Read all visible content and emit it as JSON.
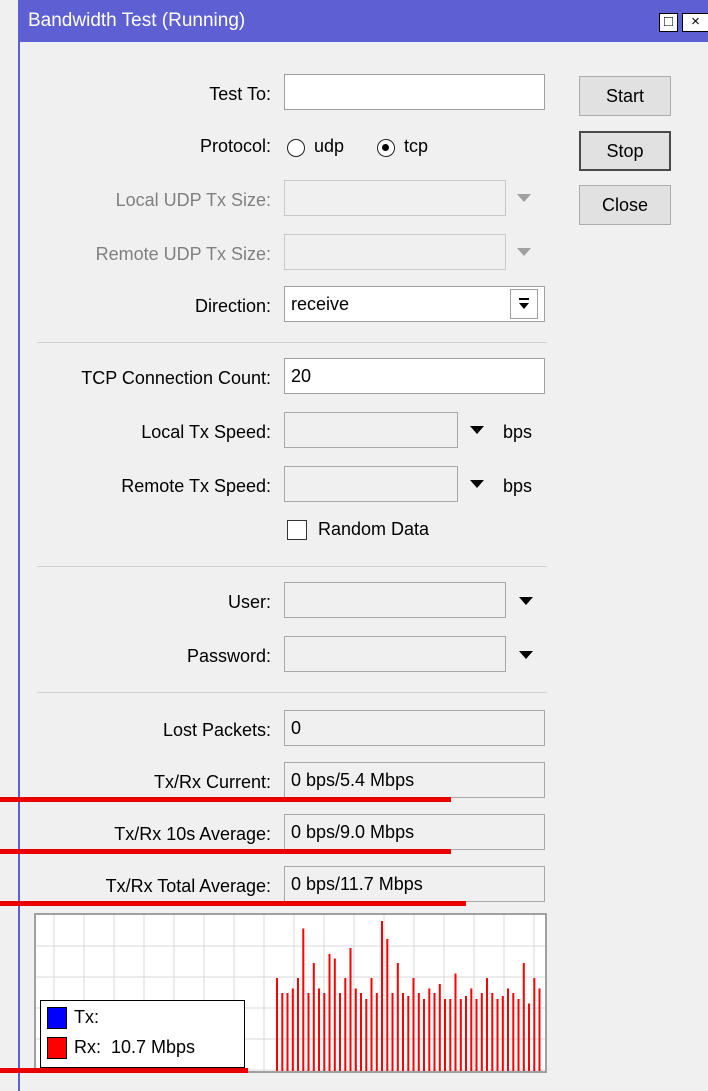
{
  "window": {
    "title": "Bandwidth Test (Running)",
    "controls": [
      "□",
      "×"
    ]
  },
  "buttons": {
    "start": "Start",
    "stop": "Stop",
    "close": "Close"
  },
  "form": {
    "test_to": {
      "label": "Test To:",
      "value": ""
    },
    "protocol": {
      "label": "Protocol:",
      "options": [
        "udp",
        "tcp"
      ],
      "selected": "tcp"
    },
    "local_udp_tx_size": {
      "label": "Local UDP Tx Size:",
      "value": ""
    },
    "remote_udp_tx_size": {
      "label": "Remote UDP Tx Size:",
      "value": ""
    },
    "direction": {
      "label": "Direction:",
      "value": "receive"
    },
    "tcp_connection_count": {
      "label": "TCP Connection Count:",
      "value": "20"
    },
    "local_tx_speed": {
      "label": "Local Tx Speed:",
      "value": "",
      "unit": "bps"
    },
    "remote_tx_speed": {
      "label": "Remote Tx Speed:",
      "value": "",
      "unit": "bps"
    },
    "random_data": {
      "label": "Random Data",
      "checked": false
    },
    "user": {
      "label": "User:",
      "value": ""
    },
    "password": {
      "label": "Password:",
      "value": ""
    }
  },
  "stats": {
    "lost_packets": {
      "label": "Lost Packets:",
      "value": "0"
    },
    "current": {
      "label": "Tx/Rx Current:",
      "value": "0 bps/5.4 Mbps"
    },
    "avg10": {
      "label": "Tx/Rx 10s Average:",
      "value": "0 bps/9.0 Mbps"
    },
    "total_avg": {
      "label": "Tx/Rx Total Average:",
      "value": "0 bps/11.7 Mbps"
    }
  },
  "legend": {
    "tx_label": "Tx:",
    "tx_value": "",
    "rx_label": "Rx:",
    "rx_value": "10.7 Mbps"
  },
  "colors": {
    "titlebar": "#5f5fd4",
    "tx": "#0000ff",
    "rx": "#ff0000",
    "annotation": "#e80000"
  },
  "chart_data": {
    "type": "bar",
    "series": [
      {
        "name": "Tx",
        "values": []
      },
      {
        "name": "Rx",
        "values": [
          62,
          52,
          52,
          55,
          62,
          95,
          52,
          72,
          55,
          52,
          78,
          75,
          52,
          62,
          82,
          55,
          52,
          48,
          62,
          52,
          100,
          88,
          52,
          72,
          52,
          50,
          62,
          52,
          48,
          55,
          52,
          58,
          48,
          48,
          65,
          48,
          50,
          55,
          48,
          52,
          62,
          52,
          48,
          50,
          55,
          52,
          48,
          72,
          45,
          62,
          55
        ]
      }
    ]
  }
}
